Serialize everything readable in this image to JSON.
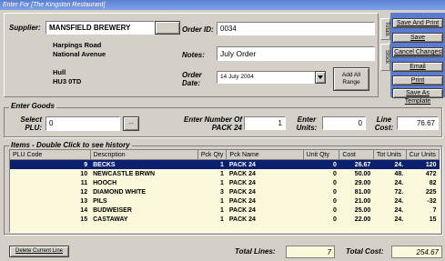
{
  "window": {
    "title": "Enter For [The Kingston Restaurant]"
  },
  "header": {
    "supplier_label": "Supplier:",
    "supplier_value": "MANSFIELD BREWERY",
    "address_lines": [
      "Harpings Road",
      "National Avenue",
      "",
      "Hull",
      "HU3 0TD"
    ],
    "order_id_label": "Order ID:",
    "order_id_value": "0034",
    "notes_label": "Notes:",
    "notes_value": "July Order",
    "order_date_label": "Order Date:",
    "order_date_value": "14    July    2004",
    "add_all_range_label": "Add All Range"
  },
  "side_tabs": [
    "Totals",
    "Stock"
  ],
  "actions": [
    "Save And Print",
    "Save",
    "Cancel Changes",
    "Email",
    "Print",
    "Save As Template"
  ],
  "enter_goods": {
    "group_label": "Enter Goods",
    "select_plu_label": "Select PLU:",
    "select_plu_value": "0",
    "browse_label": "...",
    "enter_number_label": "Enter Number Of PACK 24",
    "enter_number_value": "1",
    "enter_units_label": "Enter Units:",
    "enter_units_value": "0",
    "line_cost_label": "Line Cost:",
    "line_cost_value": "76.67"
  },
  "items": {
    "group_label": "Items - Double Click to see history",
    "columns": [
      "PLU Code",
      "Description",
      "Pck Qty",
      "Pck Name",
      "Unit Qty",
      "Cost",
      "Tot Units",
      "Cur Units"
    ],
    "rows": [
      [
        "9",
        "BECKS",
        "1",
        "PACK 24",
        "0",
        "26.67",
        "24.",
        "120"
      ],
      [
        "10",
        "NEWCASTLE BRWN",
        "1",
        "PACK 24",
        "0",
        "50.00",
        "48.",
        "472"
      ],
      [
        "11",
        "HOOCH",
        "1",
        "PACK 24",
        "0",
        "29.00",
        "24.",
        "82"
      ],
      [
        "12",
        "DIAMOND WHITE",
        "3",
        "PACK 24",
        "0",
        "81.00",
        "72.",
        "225"
      ],
      [
        "13",
        "PILS",
        "1",
        "PACK 24",
        "0",
        "21.00",
        "24.",
        "-32"
      ],
      [
        "14",
        "BUDWEISER",
        "1",
        "PACK 24",
        "0",
        "25.00",
        "24.",
        "7"
      ],
      [
        "15",
        "CASTAWAY",
        "1",
        "PACK 24",
        "0",
        "22.00",
        "24.",
        "15"
      ]
    ]
  },
  "footer": {
    "delete_button": "Delete Current Line",
    "total_lines_label": "Total Lines:",
    "total_lines_value": "7",
    "total_cost_label": "Total Cost:",
    "total_cost_value": "254.67"
  }
}
